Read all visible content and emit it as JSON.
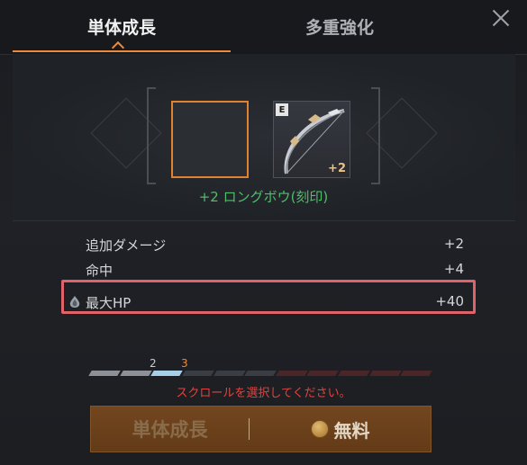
{
  "tabs": {
    "single": "単体成長",
    "multi": "多重強化"
  },
  "item": {
    "grade": "E",
    "enchant": "+2",
    "name": "+2 ロングボウ(刻印)",
    "icon": "longbow-icon"
  },
  "stats": [
    {
      "label": "追加ダメージ",
      "value": "+2"
    },
    {
      "label": "命中",
      "value": "+4"
    },
    {
      "label": "最大HP",
      "value": "+40"
    }
  ],
  "progress": {
    "labels": [
      "2",
      "3"
    ],
    "current": 3,
    "filled": 2,
    "total_segments": 11
  },
  "warning": "スクロールを選択してください。",
  "action": {
    "left_label": "単体成長",
    "right_label": "無料"
  },
  "colors": {
    "accent": "#e98a3c",
    "item_name": "#4fbf6a",
    "warning": "#e2433f",
    "highlight": "#e0636a"
  }
}
